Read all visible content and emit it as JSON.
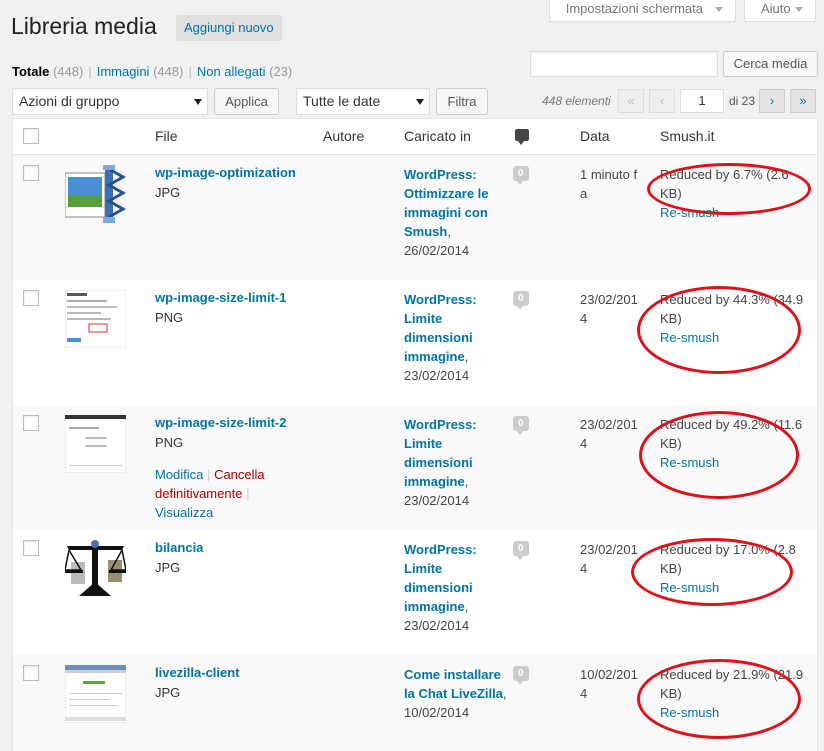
{
  "header": {
    "screen_options": "Impostazioni schermata",
    "help": "Aiuto",
    "title": "Libreria media",
    "add_new": "Aggiungi nuovo"
  },
  "filters": {
    "total_label": "Totale",
    "total_count": "(448)",
    "images_label": "Immagini",
    "images_count": "(448)",
    "unattached_label": "Non allegati",
    "unattached_count": "(23)",
    "separator": "|"
  },
  "search": {
    "placeholder": "",
    "button": "Cerca media"
  },
  "toolbar": {
    "bulk_actions": "Azioni di gruppo",
    "apply": "Applica",
    "all_dates": "Tutte le date",
    "filter": "Filtra"
  },
  "pagination": {
    "items": "448 elementi",
    "first": "«",
    "prev": "‹",
    "current": "1",
    "of": "di 23",
    "next": "›",
    "last": "»"
  },
  "columns": {
    "file": "File",
    "author": "Autore",
    "uploaded_to": "Caricato in",
    "comments_icon": "comment-bubble-icon",
    "date": "Data",
    "smush": "Smush.it"
  },
  "rows": [
    {
      "title": "wp-image-optimization",
      "type": "JPG",
      "thumb": "compress-icon",
      "post": "WordPress: Ottimizzare le immagini con Smush",
      "post_date": ", 26/02/2014",
      "comments": "0",
      "date": "1 minuto fa",
      "smush_text": "Reduced by 6.7% (2.6 KB)",
      "resmush": "Re-smush"
    },
    {
      "title": "wp-image-size-limit-1",
      "type": "PNG",
      "thumb": "screenshot-thumb",
      "post": "WordPress: Limite dimensioni immagine",
      "post_date": ", 23/02/2014",
      "comments": "0",
      "date": "23/02/2014",
      "smush_text": "Reduced by 44.3% (34.9 KB)",
      "resmush": "Re-smush"
    },
    {
      "title": "wp-image-size-limit-2",
      "type": "PNG",
      "thumb": "screenshot-thumb",
      "actions": {
        "edit": "Modifica",
        "delete": "Cancella definitivamente",
        "view": "Visualizza",
        "sep": "|"
      },
      "post": "WordPress: Limite dimensioni immagine",
      "post_date": ", 23/02/2014",
      "comments": "0",
      "date": "23/02/2014",
      "smush_text": "Reduced by 49.2% (11.6 KB)",
      "resmush": "Re-smush"
    },
    {
      "title": "bilancia",
      "type": "JPG",
      "thumb": "scale-icon",
      "post": "WordPress: Limite dimensioni immagine",
      "post_date": ", 23/02/2014",
      "comments": "0",
      "date": "23/02/2014",
      "smush_text": "Reduced by 17.0% (2.8 KB)",
      "resmush": "Re-smush"
    },
    {
      "title": "livezilla-client",
      "type": "JPG",
      "thumb": "screenshot-thumb",
      "post": "Come installare la Chat LiveZilla",
      "post_date": ", 10/02/2014",
      "comments": "0",
      "date": "10/02/2014",
      "smush_text": "Reduced by 21.9% (21.9 KB)",
      "resmush": "Re-smush"
    }
  ],
  "colors": {
    "link": "#0074a2",
    "delete": "#aa0000",
    "highlight": "#e0101a"
  }
}
